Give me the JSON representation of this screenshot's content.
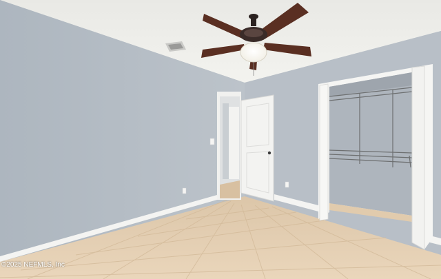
{
  "photo": {
    "subject": "empty-bedroom",
    "watermark": "©2025 NEFMLS, Inc"
  },
  "colors": {
    "ceiling": "#eeeeea",
    "left_wall": "#b3bbc3",
    "back_wall": "#bcc3ca",
    "right_wall": "#b7bec6",
    "floor_tile": "#e3cdaf",
    "baseboard": "#f4f4f2",
    "door": "#f2f2f0",
    "fan_blade": "#5a2f22"
  }
}
